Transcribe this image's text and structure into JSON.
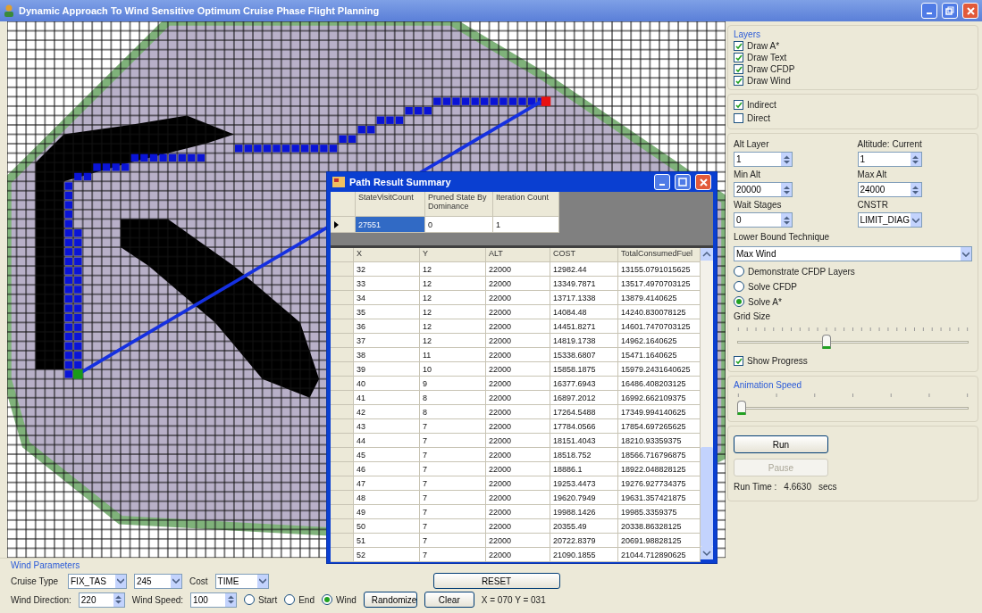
{
  "window": {
    "title": "Dynamic Approach To Wind Sensitive Optimum Cruise Phase Flight Planning"
  },
  "layers": {
    "title": "Layers",
    "items": [
      {
        "label": "Draw A*",
        "checked": true
      },
      {
        "label": "Draw Text",
        "checked": true
      },
      {
        "label": "Draw CFDP",
        "checked": true
      },
      {
        "label": "Draw Wind",
        "checked": true
      }
    ]
  },
  "routing": [
    {
      "label": "Indirect",
      "checked": true
    },
    {
      "label": "Direct",
      "checked": false
    }
  ],
  "fields": [
    {
      "label": "Alt Layer",
      "value": "1",
      "kind": "spinner"
    },
    {
      "label": "Altitude: Current",
      "value": "1",
      "kind": "spinner"
    },
    {
      "label": "Min Alt",
      "value": "20000",
      "kind": "spinner"
    },
    {
      "label": "Max Alt",
      "value": "24000",
      "kind": "spinner"
    },
    {
      "label": "Wait Stages",
      "value": "0",
      "kind": "spinner"
    },
    {
      "label": "CNSTR",
      "value": "LIMIT_DIAG",
      "kind": "dropdown"
    }
  ],
  "lower_bound": {
    "label": "Lower Bound Technique",
    "value": "Max Wind"
  },
  "modes": [
    {
      "label": "Demonstrate CFDP Layers",
      "selected": false
    },
    {
      "label": "Solve CFDP",
      "selected": false
    },
    {
      "label": "Solve A*",
      "selected": true
    }
  ],
  "grid_size": {
    "label": "Grid Size",
    "level": 0.38
  },
  "show_progress": {
    "label": "Show Progress",
    "checked": true
  },
  "animation_speed": {
    "title": "Animation Speed",
    "level": 0
  },
  "run": {
    "run_label": "Run",
    "pause_label": "Pause",
    "pause_disabled": true,
    "time_label": "Run Time :",
    "time_value": "4.6630",
    "time_unit": "secs"
  },
  "wind_parameters": {
    "title": "Wind Parameters",
    "cruise_label": "Cruise Type",
    "cruise_type": "FIX_TAS",
    "speed": "245",
    "cost_label": "Cost",
    "cost": "TIME",
    "reset_label": "RESET",
    "direction_label": "Wind Direction:",
    "direction": "220",
    "wind_speed_label": "Wind Speed:",
    "wind_speed": "100",
    "place": [
      {
        "label": "Start",
        "selected": false
      },
      {
        "label": "End",
        "selected": false
      },
      {
        "label": "Wind",
        "selected": true
      }
    ],
    "buttons": [
      "Randomize",
      "Clear"
    ],
    "position": "X = 070 Y = 031"
  },
  "dialog": {
    "title": "Path Result Summary",
    "summary": {
      "columns": [
        "StateVisitCount",
        "Pruned State By Dominance",
        "Iteration Count"
      ],
      "row": [
        "27551",
        "0",
        "1"
      ]
    },
    "results": {
      "columns": [
        "X",
        "Y",
        "ALT",
        "COST",
        "TotalConsumedFuel"
      ],
      "rows": [
        [
          "32",
          "12",
          "22000",
          "12982.44",
          "13155.0791015625"
        ],
        [
          "33",
          "12",
          "22000",
          "13349.7871",
          "13517.4970703125"
        ],
        [
          "34",
          "12",
          "22000",
          "13717.1338",
          "13879.4140625"
        ],
        [
          "35",
          "12",
          "22000",
          "14084.48",
          "14240.830078125"
        ],
        [
          "36",
          "12",
          "22000",
          "14451.8271",
          "14601.7470703125"
        ],
        [
          "37",
          "12",
          "22000",
          "14819.1738",
          "14962.1640625"
        ],
        [
          "38",
          "11",
          "22000",
          "15338.6807",
          "15471.1640625"
        ],
        [
          "39",
          "10",
          "22000",
          "15858.1875",
          "15979.2431640625"
        ],
        [
          "40",
          "9",
          "22000",
          "16377.6943",
          "16486.408203125"
        ],
        [
          "41",
          "8",
          "22000",
          "16897.2012",
          "16992.662109375"
        ],
        [
          "42",
          "8",
          "22000",
          "17264.5488",
          "17349.994140625"
        ],
        [
          "43",
          "7",
          "22000",
          "17784.0566",
          "17854.697265625"
        ],
        [
          "44",
          "7",
          "22000",
          "18151.4043",
          "18210.93359375"
        ],
        [
          "45",
          "7",
          "22000",
          "18518.752",
          "18566.716796875"
        ],
        [
          "46",
          "7",
          "22000",
          "18886.1",
          "18922.048828125"
        ],
        [
          "47",
          "7",
          "22000",
          "19253.4473",
          "19276.927734375"
        ],
        [
          "48",
          "7",
          "22000",
          "19620.7949",
          "19631.357421875"
        ],
        [
          "49",
          "7",
          "22000",
          "19988.1426",
          "19985.3359375"
        ],
        [
          "50",
          "7",
          "22000",
          "20355.49",
          "20338.86328125"
        ],
        [
          "51",
          "7",
          "22000",
          "20722.8379",
          "20691.98828125"
        ],
        [
          "52",
          "7",
          "22000",
          "21090.1855",
          "21044.712890625"
        ]
      ]
    }
  }
}
